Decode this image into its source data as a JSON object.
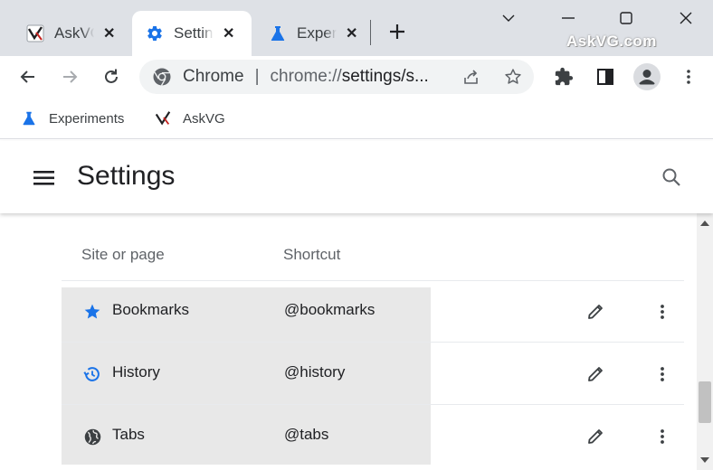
{
  "tabs": [
    {
      "label": "AskVG",
      "close": "✕",
      "icon": "askvg-logo-icon",
      "active": false
    },
    {
      "label": "Settings",
      "close": "✕",
      "icon": "gear-icon",
      "active": true
    },
    {
      "label": "Experiments",
      "close": "✕",
      "icon": "flask-icon",
      "active": false
    }
  ],
  "watermark": "AskVG.com",
  "omnibox": {
    "site_label": "Chrome",
    "separator": "|",
    "url_scheme": "chrome://",
    "url_rest": "settings/s..."
  },
  "bookmarks": [
    {
      "label": "Experiments",
      "icon": "flask-icon"
    },
    {
      "label": "AskVG",
      "icon": "askvg-logo-icon"
    }
  ],
  "settings": {
    "title": "Settings",
    "columns": {
      "site": "Site or page",
      "shortcut": "Shortcut"
    },
    "rows": [
      {
        "name": "Bookmarks",
        "shortcut": "@bookmarks",
        "icon": "star-icon"
      },
      {
        "name": "History",
        "shortcut": "@history",
        "icon": "history-icon"
      },
      {
        "name": "Tabs",
        "shortcut": "@tabs",
        "icon": "globe-icon"
      }
    ]
  },
  "colors": {
    "accent": "#1a73e8",
    "tabstrip": "#dee1e6",
    "omnibox": "#f1f3f4",
    "row_highlight": "#e8e8e8",
    "flask": "#1a73e8"
  }
}
